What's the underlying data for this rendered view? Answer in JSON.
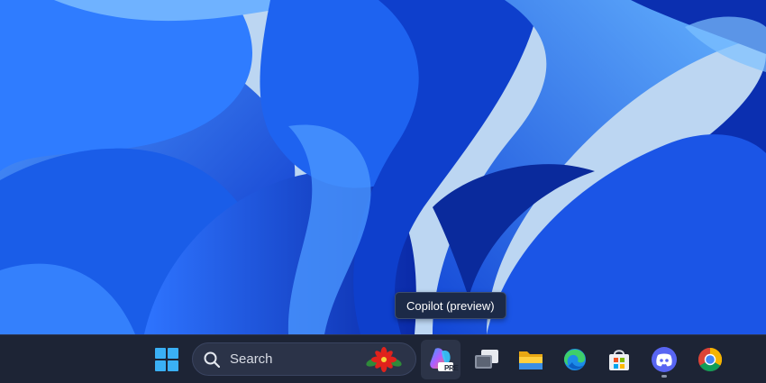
{
  "tooltip": {
    "text": "Copilot (preview)"
  },
  "taskbar": {
    "search": {
      "label": "Search"
    },
    "apps": [
      {
        "icon": "windows-start-icon"
      },
      {
        "icon": "copilot-icon",
        "badge": "PRE"
      },
      {
        "icon": "task-view-icon"
      },
      {
        "icon": "file-explorer-icon"
      },
      {
        "icon": "edge-icon"
      },
      {
        "icon": "microsoft-store-icon"
      },
      {
        "icon": "discord-icon"
      },
      {
        "icon": "chrome-icon"
      }
    ]
  },
  "colors": {
    "taskbar": "#1d2435",
    "wallpaper_blue": "#1a5de8",
    "start_blue": "#3ab0f5"
  }
}
